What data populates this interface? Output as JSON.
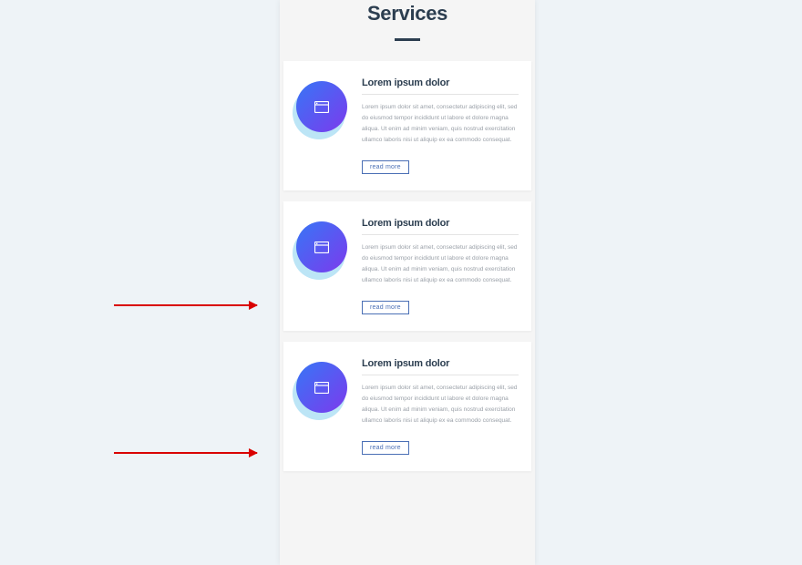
{
  "page": {
    "title": "Services"
  },
  "cards": [
    {
      "title": "Lorem ipsum dolor",
      "desc": "Lorem ipsum dolor sit amet, consectetur adipiscing elit, sed do eiusmod tempor incididunt ut labore et dolore magna aliqua. Ut enim ad minim veniam, quis nostrud exercitation ullamco laboris nisi ut aliquip ex ea commodo consequat.",
      "cta": "read more"
    },
    {
      "title": "Lorem ipsum dolor",
      "desc": "Lorem ipsum dolor sit amet, consectetur adipiscing elit, sed do eiusmod tempor incididunt ut labore et dolore magna aliqua. Ut enim ad minim veniam, quis nostrud exercitation ullamco laboris nisi ut aliquip ex ea commodo consequat.",
      "cta": "read more"
    },
    {
      "title": "Lorem ipsum dolor",
      "desc": "Lorem ipsum dolor sit amet, consectetur adipiscing elit, sed do eiusmod tempor incididunt ut labore et dolore magna aliqua. Ut enim ad minim veniam, quis nostrud exercitation ullamco laboris nisi ut aliquip ex ea commodo consequat.",
      "cta": "read more"
    }
  ],
  "annotations": {
    "arrow1": true,
    "arrow2": true
  }
}
